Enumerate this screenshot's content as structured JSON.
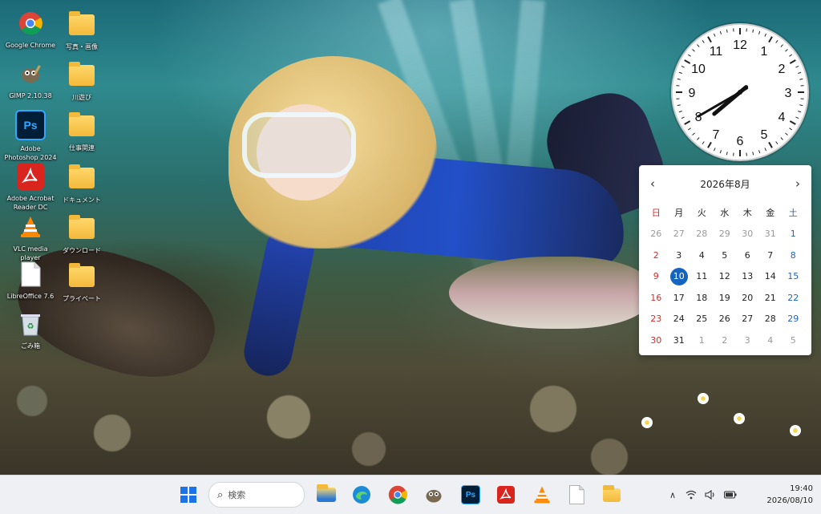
{
  "desktop": {
    "icons": [
      {
        "label": "Google Chrome",
        "icon": "chrome-icon"
      },
      {
        "label": "GIMP 2.10.38",
        "icon": "gimp-icon"
      },
      {
        "label": "Adobe Photoshop 2024",
        "icon": "photoshop-icon"
      },
      {
        "label": "Adobe Acrobat Reader DC",
        "icon": "acrobat-icon"
      },
      {
        "label": "VLC media player",
        "icon": "vlc-icon"
      },
      {
        "label": "LibreOffice 7.6",
        "icon": "libreoffice-icon"
      },
      {
        "label": "ごみ箱",
        "icon": "recycle-bin-icon"
      },
      {
        "label": "写真・画像",
        "icon": "folder-icon"
      },
      {
        "label": "川遊び",
        "icon": "folder-icon"
      },
      {
        "label": "仕事関連",
        "icon": "folder-icon"
      },
      {
        "label": "ドキュメント",
        "icon": "folder-icon"
      },
      {
        "label": "ダウンロード",
        "icon": "folder-icon"
      },
      {
        "label": "プライベート",
        "icon": "folder-icon"
      }
    ]
  },
  "clock": {
    "numbers": [
      "12",
      "1",
      "2",
      "3",
      "4",
      "5",
      "6",
      "7",
      "8",
      "9",
      "10",
      "11"
    ],
    "hour": 7,
    "minute": 40
  },
  "calendar": {
    "title": "2026年8月",
    "prev": "‹",
    "next": "›",
    "weekdays": [
      "日",
      "月",
      "火",
      "水",
      "木",
      "金",
      "土"
    ],
    "days": [
      [
        "26",
        "27",
        "28",
        "29",
        "30",
        "31",
        "1"
      ],
      [
        "2",
        "3",
        "4",
        "5",
        "6",
        "7",
        "8"
      ],
      [
        "9",
        "10",
        "11",
        "12",
        "13",
        "14",
        "15"
      ],
      [
        "16",
        "17",
        "18",
        "19",
        "20",
        "21",
        "22"
      ],
      [
        "23",
        "24",
        "25",
        "26",
        "27",
        "28",
        "29"
      ],
      [
        "30",
        "31",
        "1",
        "2",
        "3",
        "4",
        "5"
      ]
    ],
    "today": "10"
  },
  "taskbar": {
    "search_placeholder": "検索",
    "apps": [
      "start-icon",
      "file-explorer-icon",
      "edge-icon",
      "chrome-icon",
      "gimp-icon",
      "photoshop-icon",
      "acrobat-icon",
      "vlc-icon",
      "libreoffice-icon",
      "folder-icon"
    ],
    "time": "19:40",
    "date": "2026/08/10"
  },
  "colors": {
    "taskbar_bg": "#eef0f3",
    "today_highlight": "#1565c0",
    "sunday": "#d32f2f",
    "saturday": "#1e63c8"
  }
}
